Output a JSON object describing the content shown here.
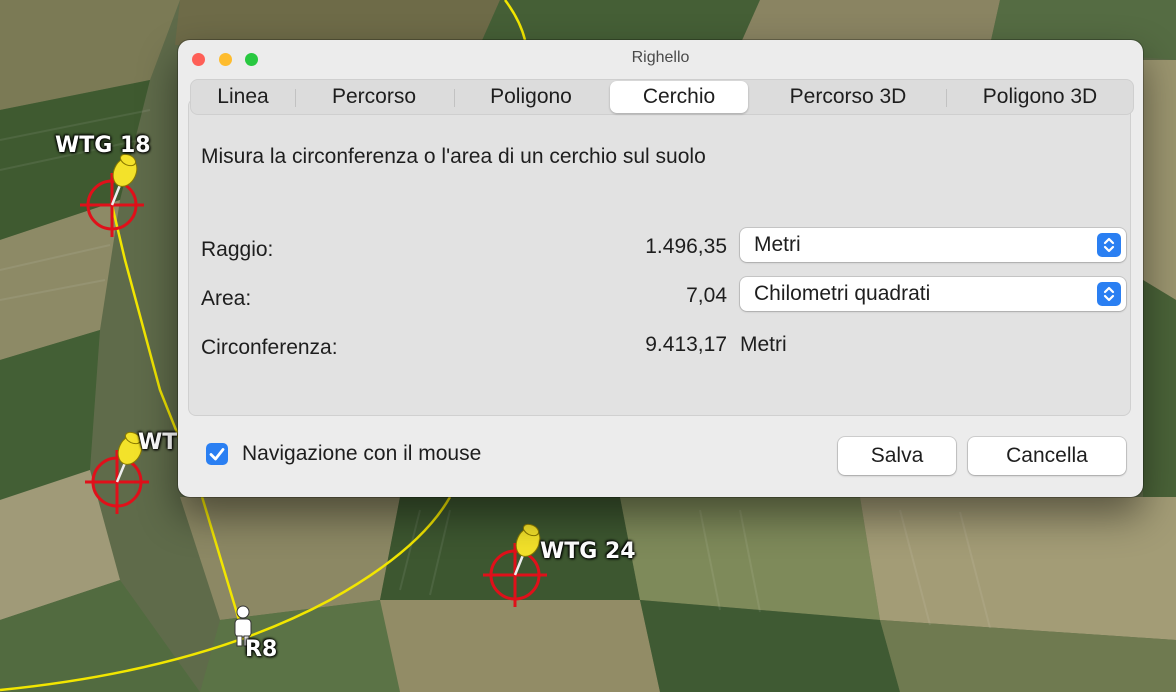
{
  "map": {
    "markers": [
      {
        "label": "WTG 18"
      },
      {
        "label": "WT"
      },
      {
        "label": "WTG 24"
      },
      {
        "label": "R8"
      }
    ]
  },
  "window": {
    "title": "Righello",
    "tabs": [
      {
        "label": "Linea",
        "selected": false
      },
      {
        "label": "Percorso",
        "selected": false
      },
      {
        "label": "Poligono",
        "selected": false
      },
      {
        "label": "Cerchio",
        "selected": true
      },
      {
        "label": "Percorso 3D",
        "selected": false
      },
      {
        "label": "Poligono 3D",
        "selected": false
      }
    ],
    "description": "Misura la circonferenza o l'area di un cerchio sul suolo",
    "rows": {
      "radius": {
        "label": "Raggio:",
        "value": "1.496,35",
        "unit": "Metri"
      },
      "area": {
        "label": "Area:",
        "value": "7,04",
        "unit": "Chilometri quadrati"
      },
      "circumference": {
        "label": "Circonferenza:",
        "value": "9.413,17",
        "unit": "Metri"
      }
    },
    "mouse_navigation": {
      "label": "Navigazione con il mouse",
      "checked": true
    },
    "save_label": "Salva",
    "cancel_label": "Cancella"
  },
  "colors": {
    "accent": "#2a7ff2",
    "close": "#fe5f57",
    "minimize": "#febc2e",
    "zoom": "#28c840",
    "path_line": "#f2e600",
    "target": "#e0101a",
    "pin": "#f3e22a"
  }
}
